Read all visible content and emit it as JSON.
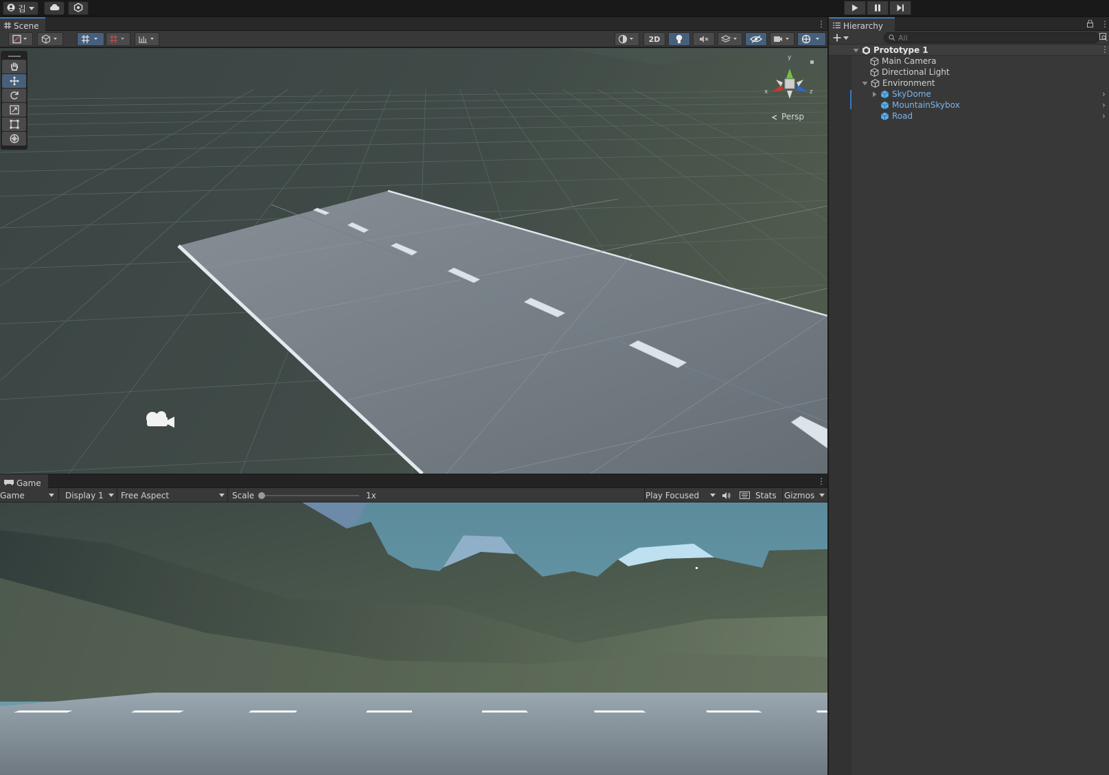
{
  "topbar": {
    "account_label": "김",
    "play_controls": [
      "play",
      "pause",
      "step"
    ]
  },
  "scene": {
    "tab_label": "Scene",
    "toggle_2d": "2D",
    "persp_label": "Persp",
    "gizmo_axes": {
      "y": "y",
      "x": "x",
      "z": "z"
    },
    "axis_colors": {
      "x": "#d0342c",
      "y": "#72c23a",
      "z": "#2c68d0"
    }
  },
  "game": {
    "tab_label": "Game",
    "view_select": "Game",
    "display_select": "Display 1",
    "aspect_select": "Free Aspect",
    "scale_label": "Scale",
    "scale_value": "1x",
    "play_mode": "Play Focused",
    "stats_label": "Stats",
    "gizmos_label": "Gizmos"
  },
  "hierarchy": {
    "tab_label": "Hierarchy",
    "search_placeholder": "All",
    "scene_name": "Prototype 1",
    "items": [
      {
        "label": "Main Camera"
      },
      {
        "label": "Directional Light"
      },
      {
        "label": "Environment"
      },
      {
        "label": "SkyDome"
      },
      {
        "label": "MountainSkybox"
      },
      {
        "label": "Road"
      }
    ]
  }
}
